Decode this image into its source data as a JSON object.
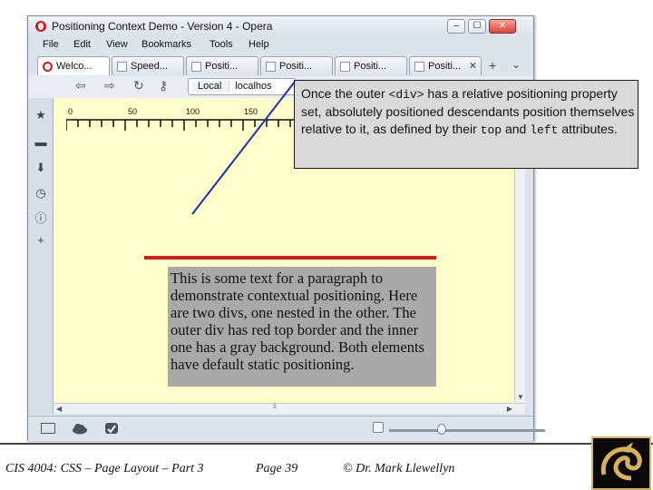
{
  "window": {
    "title": "Positioning Context Demo - Version 4 - Opera",
    "controls": {
      "minimize": "–",
      "maximize": "☐",
      "close": "✕"
    }
  },
  "menu": [
    "File",
    "Edit",
    "View",
    "Bookmarks",
    "Tools",
    "Help"
  ],
  "tabs": [
    {
      "label": "Welco...",
      "icon": "opera-icon",
      "close": "✕"
    },
    {
      "label": "Speed...",
      "icon": "speed-dial-icon",
      "close": "✕"
    },
    {
      "label": "Positi...",
      "icon": "page-icon",
      "close": "✕"
    },
    {
      "label": "Positi...",
      "icon": "page-icon",
      "close": "✕"
    },
    {
      "label": "Positi...",
      "icon": "page-icon",
      "close": "✕"
    },
    {
      "label": "Positi...",
      "icon": "page-icon",
      "close": "✕"
    }
  ],
  "tab_add": "+",
  "tab_menu": "⌄",
  "address": {
    "scheme_label": "Local",
    "url": "localhos"
  },
  "nav_icons": {
    "back": "⇦",
    "forward": "⇨",
    "reload": "↻",
    "key": "⚷"
  },
  "sidebar_icons": {
    "bookmarks": "★",
    "notes": "▬",
    "downloads": "⬇",
    "history": "◷",
    "info": "ⓘ",
    "add": "+"
  },
  "ruler_labels": [
    "0",
    "50",
    "100",
    "150"
  ],
  "paragraph_text": "This is some text for a paragraph to demonstrate contextual positioning. Here are two divs, one nested in the other. The outer div has red top border and the inner one has a gray background. Both elements have default static positioning.",
  "callout": {
    "part1": "Once the outer ",
    "code_div": "<div>",
    "part2": " has a relative positioning property set, absolutely positioned descendants position themselves relative to it, as defined by their ",
    "code_top": "top",
    "part3": " and ",
    "code_left": "left",
    "part4": " attributes."
  },
  "scroll_arrows": {
    "up": "▲",
    "down": "▼",
    "left": "◀",
    "right": "▶"
  },
  "statusbar": {
    "grip": "⁞⁞⁞"
  },
  "footer": {
    "course": "CIS 4004: CSS – Page Layout – Part 3",
    "page": "Page 39",
    "author": "© Dr. Mark Llewellyn"
  },
  "colors": {
    "page_background": "#fffdc9",
    "red_border": "#d21c1c",
    "gray_box": "#a9a9a9",
    "callout_background": "#d9d9d9",
    "pointer_line": "#1f2fb4"
  }
}
